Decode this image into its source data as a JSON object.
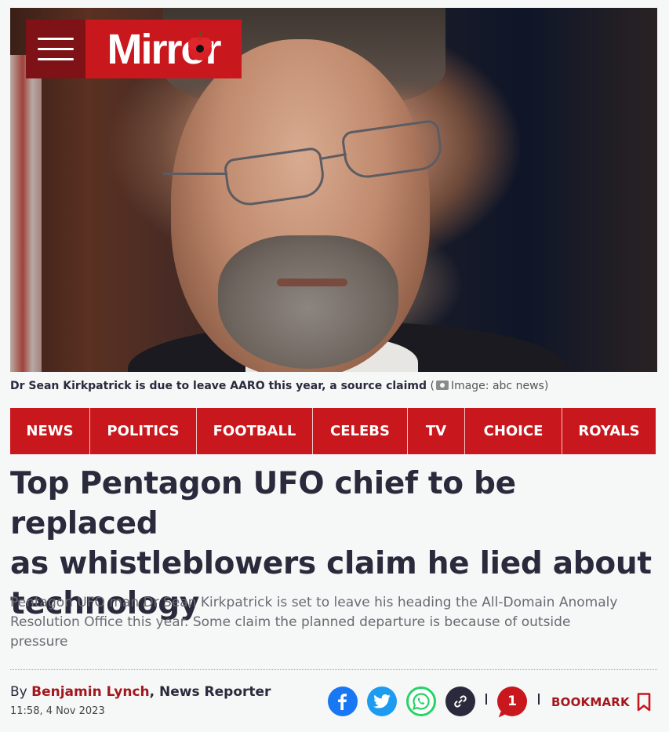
{
  "header": {
    "logo_text": "Mirror",
    "menu_label": "Menu"
  },
  "image": {
    "caption": "Dr Sean Kirkpatrick is due to leave AARO this year, a source claimd",
    "credit": "Image: abc news"
  },
  "nav": {
    "items": [
      {
        "label": "NEWS"
      },
      {
        "label": "POLITICS"
      },
      {
        "label": "FOOTBALL"
      },
      {
        "label": "CELEBS"
      },
      {
        "label": "TV"
      },
      {
        "label": "CHOICE"
      },
      {
        "label": "ROYALS"
      }
    ]
  },
  "article": {
    "headline_lines": [
      "Top Pentagon UFO chief to be replaced",
      "as whistleblowers claim he lied about",
      "technology"
    ],
    "standfirst_lines": [
      "Pentagon UFO man Dr Sean Kirkpatrick is set to leave his heading the All-Domain Anomaly",
      "Resolution Office this year. Some claim the planned departure is because of outside",
      "pressure"
    ],
    "byline": {
      "prefix": "By ",
      "author": "Benjamin Lynch",
      "separator": ", ",
      "role": "News Reporter"
    },
    "timestamp": "11:58, 4 Nov 2023"
  },
  "share": {
    "comment_count": "1",
    "bookmark_label": "BOOKMARK",
    "icons": [
      "facebook-icon",
      "twitter-icon",
      "whatsapp-icon",
      "link-icon",
      "comment-icon",
      "bookmark-icon"
    ]
  },
  "colors": {
    "brand_red": "#c9171e",
    "dark_red": "#7e1217",
    "text_dark": "#2a2a3c",
    "facebook": "#1877f2",
    "twitter": "#1d9bf0",
    "whatsapp": "#25d366",
    "link": "#2a2a3c"
  }
}
